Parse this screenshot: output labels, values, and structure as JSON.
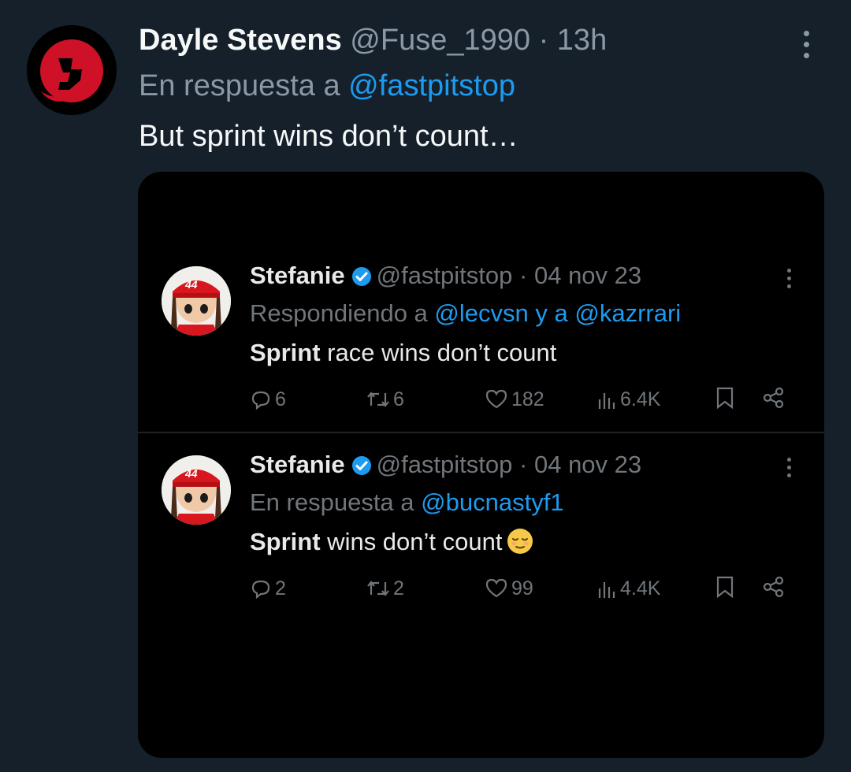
{
  "tweet": {
    "author_name": "Dayle Stevens",
    "handle": "@Fuse_1990",
    "separator": "·",
    "time": "13h",
    "reply_prefix": "En respuesta a",
    "reply_to": "@fastpitstop",
    "text": "But sprint wins don’t count…",
    "avatar_icon": "devils-logo-icon",
    "more_icon": "more-options-icon"
  },
  "embedded_screenshot": {
    "tweets": [
      {
        "name": "Stefanie",
        "handle": "@fastpitstop",
        "separator": "·",
        "date": "04 nov 23",
        "reply_prefix": "Respondiendo a",
        "reply_mention_1": "@lecvsn",
        "reply_joiner": "y a",
        "reply_mention_2": "@kazrrari",
        "text_bold": "Sprint",
        "text_rest": " race wins don’t count",
        "replies": "6",
        "retweets": "6",
        "likes": "182",
        "views": "6.4K"
      },
      {
        "name": "Stefanie",
        "handle": "@fastpitstop",
        "separator": "·",
        "date": "04 nov 23",
        "reply_prefix": "En respuesta a",
        "reply_mention_1": "@bucnastyf1",
        "text_bold": "Sprint",
        "text_rest": " wins don’t count",
        "emoji": "relieved-face-emoji",
        "replies": "2",
        "retweets": "2",
        "likes": "99",
        "views": "4.4K"
      }
    ]
  },
  "colors": {
    "background": "#15202b",
    "link": "#1d9bf0",
    "devils_red": "#ce1126"
  }
}
